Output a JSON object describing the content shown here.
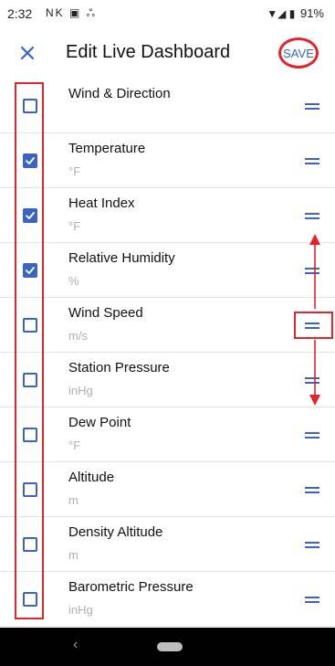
{
  "status_bar": {
    "time": "2:32",
    "left_icons": "NK ▣ ஃ",
    "signal_symbols": "▼◢ ▮",
    "battery": "91%"
  },
  "toolbar": {
    "title": "Edit Live Dashboard",
    "save_label": "SAVE",
    "close_icon": "close-icon"
  },
  "colors": {
    "accent": "#3b63c4",
    "annotation_red": "#e3242b",
    "unit_gray": "#b0b0b0",
    "nav_bar": "#000000"
  },
  "items": [
    {
      "name": "Wind & Direction",
      "unit": "",
      "checked": false
    },
    {
      "name": "Temperature",
      "unit": "°F",
      "checked": true
    },
    {
      "name": "Heat Index",
      "unit": "°F",
      "checked": true
    },
    {
      "name": "Relative Humidity",
      "unit": "%",
      "checked": true
    },
    {
      "name": "Wind Speed",
      "unit": "m/s",
      "checked": false
    },
    {
      "name": "Station Pressure",
      "unit": "inHg",
      "checked": false
    },
    {
      "name": "Dew Point",
      "unit": "°F",
      "checked": false
    },
    {
      "name": "Altitude",
      "unit": "m",
      "checked": false
    },
    {
      "name": "Density Altitude",
      "unit": "m",
      "checked": false
    },
    {
      "name": "Barometric Pressure",
      "unit": "inHg",
      "checked": false
    }
  ],
  "nav": {
    "back_symbol": "‹"
  }
}
